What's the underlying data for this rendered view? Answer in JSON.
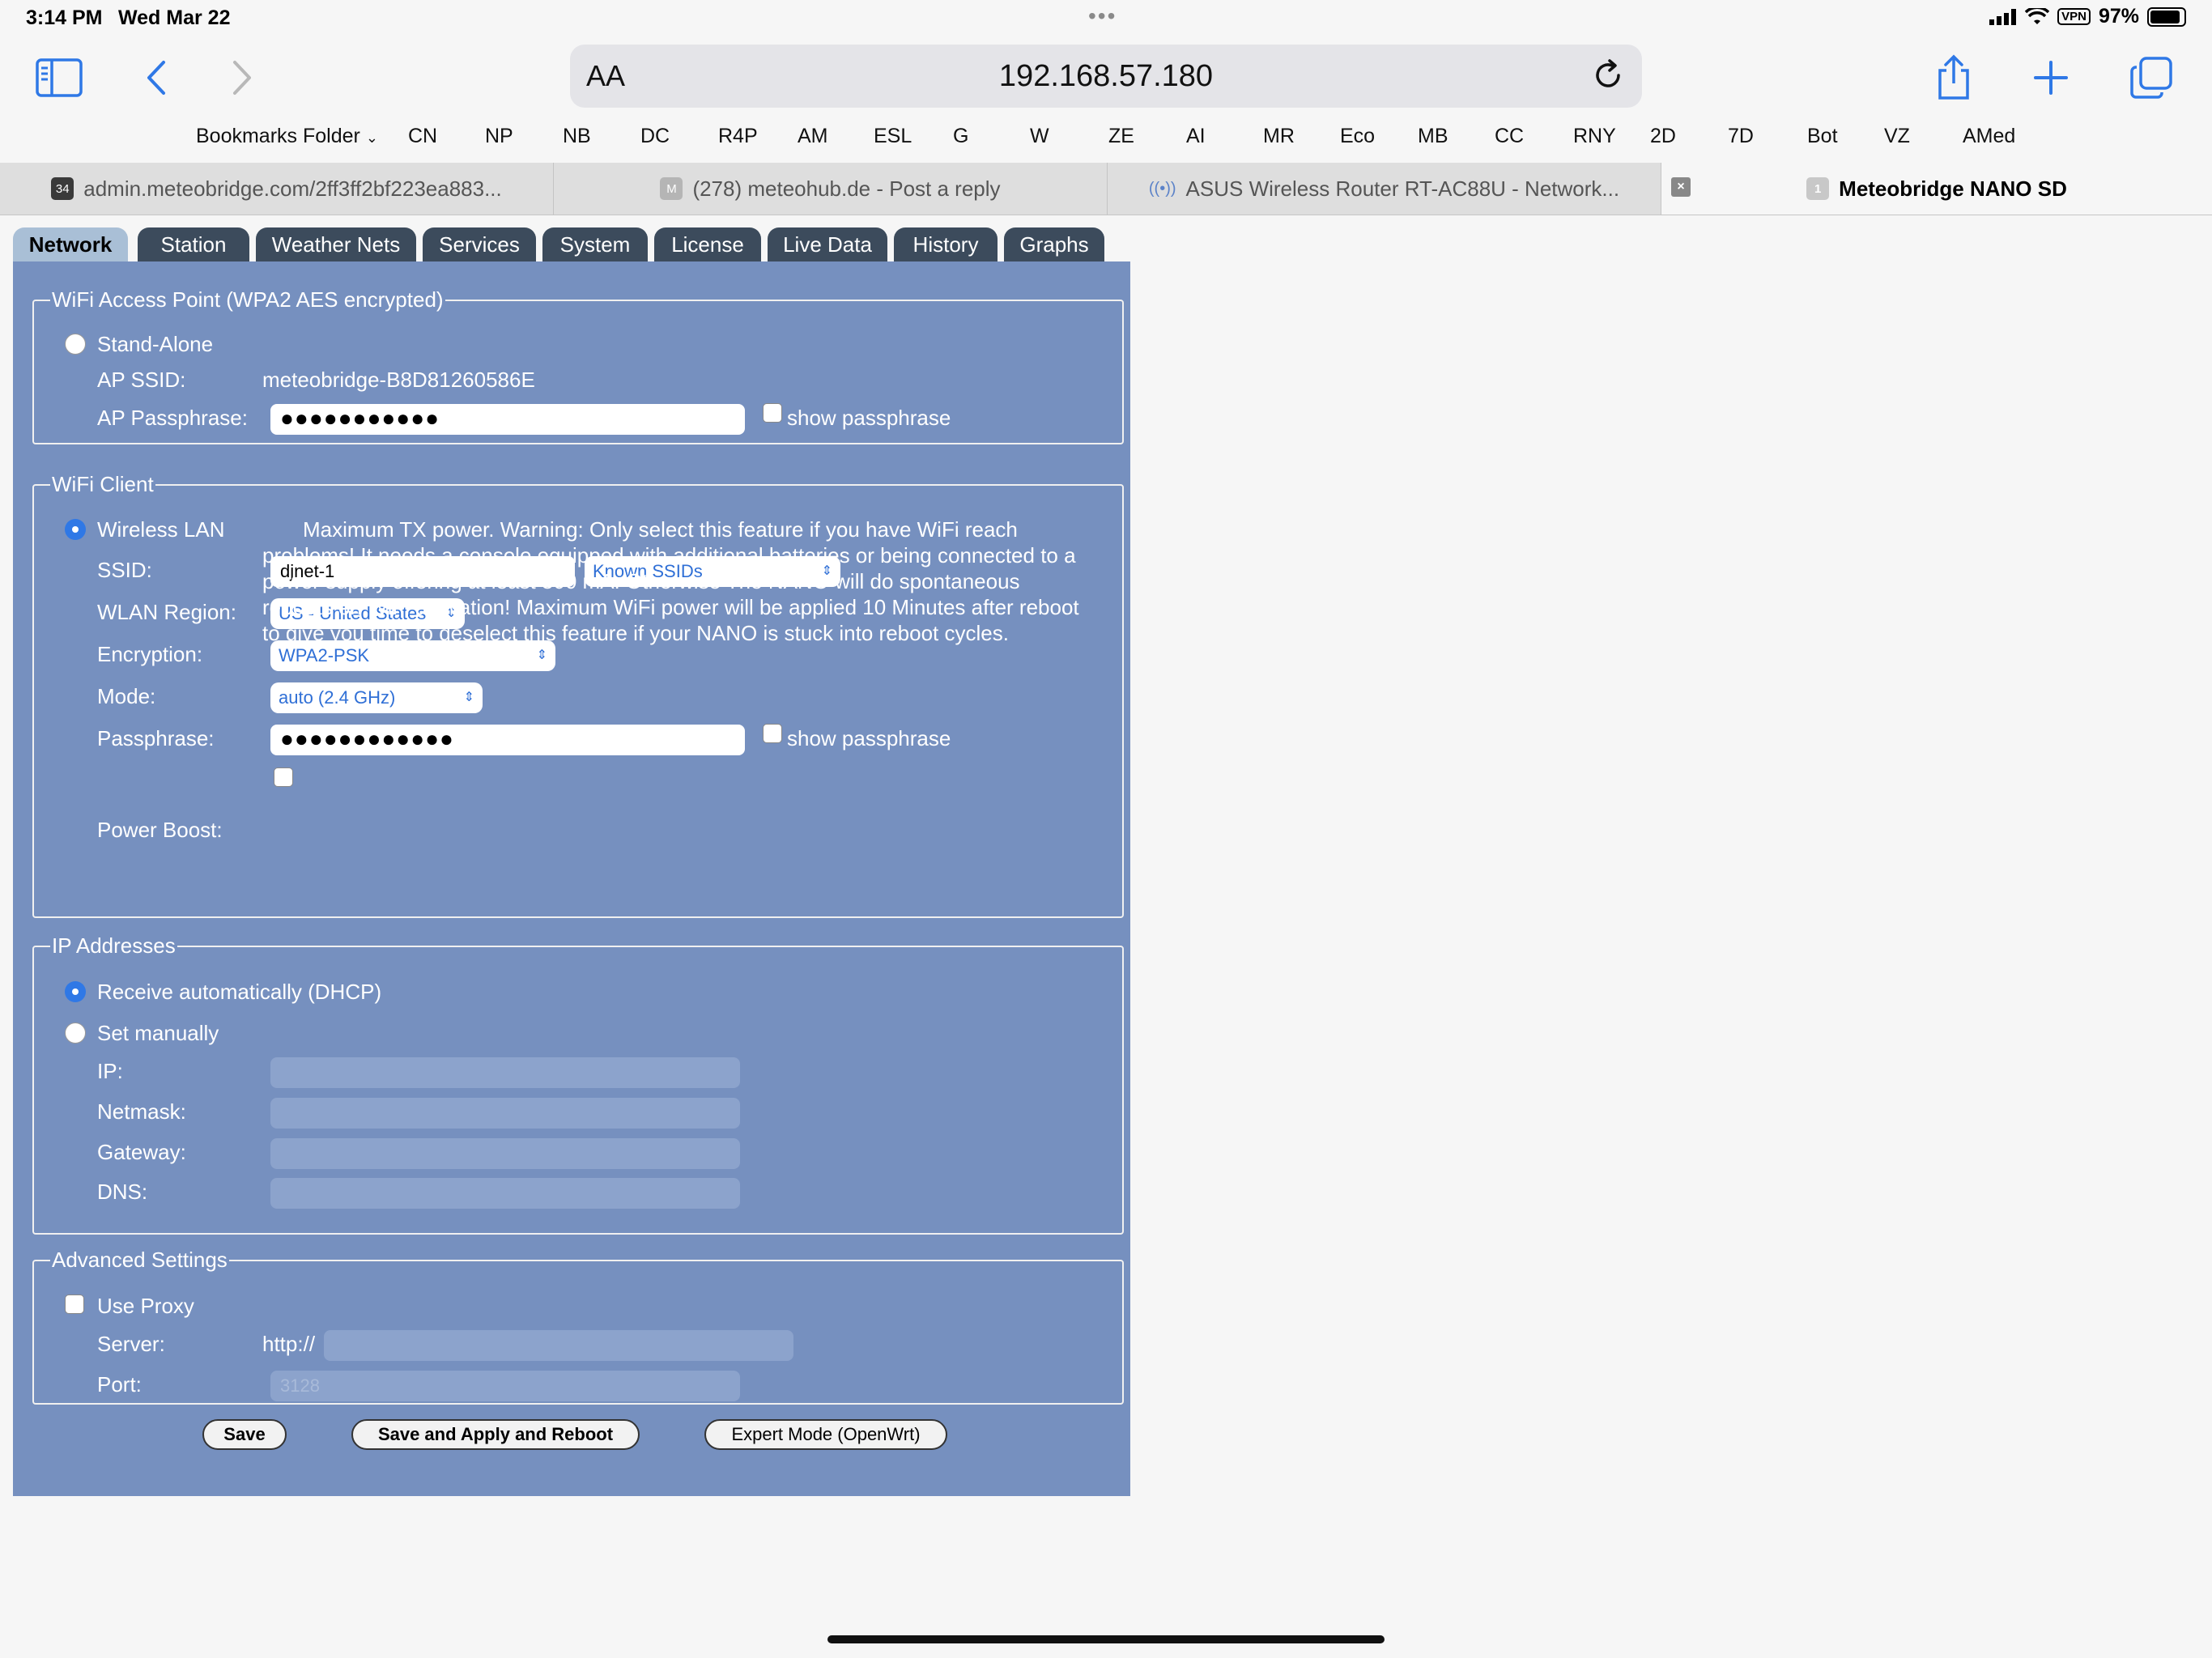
{
  "status_bar": {
    "time": "3:14 PM",
    "date": "Wed Mar 22",
    "vpn": "VPN",
    "battery": "97%"
  },
  "browser": {
    "url": "192.168.57.180",
    "aa_label": "AA",
    "bookmarks_folder": "Bookmarks Folder",
    "bookmarks": [
      "CN",
      "NP",
      "NB",
      "DC",
      "R4P",
      "AM",
      "ESL",
      "G",
      "W",
      "ZE",
      "AI",
      "MR",
      "Eco",
      "MB",
      "CC",
      "RNY",
      "2D",
      "7D",
      "Bot",
      "VZ",
      "AMed"
    ],
    "tabs": [
      {
        "title": "admin.meteobridge.com/2ff3ff2bf223ea883...",
        "favicon": "34",
        "favicon_color": "#3a3a3a"
      },
      {
        "title": "(278) meteohub.de - Post a reply",
        "favicon": "M",
        "favicon_color": "#b5b5b5"
      },
      {
        "title": "ASUS Wireless Router RT-AC88U - Network...",
        "favicon": "((•))",
        "favicon_color": "#7a9bd0"
      },
      {
        "title": "Meteobridge NANO SD",
        "favicon": "1",
        "favicon_color": "#bdbdbd",
        "active": true
      }
    ]
  },
  "meteobridge": {
    "tabs": [
      "Network",
      "Station",
      "Weather Nets",
      "Services",
      "System",
      "License",
      "Live Data",
      "History",
      "Graphs"
    ],
    "active_tab": "Network",
    "wifi_ap": {
      "legend": "WiFi Access Point (WPA2 AES encrypted)",
      "standalone_label": "Stand-Alone",
      "ssid_label": "AP SSID:",
      "ssid_value": "meteobridge-B8D81260586E",
      "passphrase_label": "AP Passphrase:",
      "passphrase_value": "●●●●●●●●●●●",
      "show_passphrase": "show passphrase"
    },
    "wifi_client": {
      "legend": "WiFi Client",
      "wireless_lan_label": "Wireless LAN",
      "ssid_label": "SSID:",
      "ssid_value": "djnet-1",
      "known_ssids": "Known SSIDs",
      "region_label": "WLAN Region:",
      "region_value": "US - United States",
      "encryption_label": "Encryption:",
      "encryption_value": "WPA2-PSK",
      "mode_label": "Mode:",
      "mode_value": "auto (2.4 GHz)",
      "passphrase_label": "Passphrase:",
      "passphrase_value": "●●●●●●●●●●●●",
      "show_passphrase": "show passphrase",
      "power_boost_label": "Power Boost:",
      "power_boost_text": "Maximum TX power. Warning: Only select this feature if you have WiFi reach problems! It needs a console equipped with additional batteries or being connected to a power supply offering at least 500 mA. Otherwise The NANO will do spontaneous reboots on WiFi activation! Maximum WiFi power will be applied 10 Minutes after reboot to give you time to deselect this feature if your NANO is stuck into reboot cycles."
    },
    "ip": {
      "legend": "IP Addresses",
      "dhcp_label": "Receive automatically (DHCP)",
      "manual_label": "Set manually",
      "ip_label": "IP:",
      "netmask_label": "Netmask:",
      "gateway_label": "Gateway:",
      "dns_label": "DNS:"
    },
    "advanced": {
      "legend": "Advanced Settings",
      "use_proxy_label": "Use Proxy",
      "server_label": "Server:",
      "server_prefix": "http://",
      "port_label": "Port:",
      "port_placeholder": "3128"
    },
    "buttons": {
      "save": "Save",
      "save_apply_reboot": "Save and Apply and Reboot",
      "expert_mode": "Expert Mode (OpenWrt)"
    }
  }
}
